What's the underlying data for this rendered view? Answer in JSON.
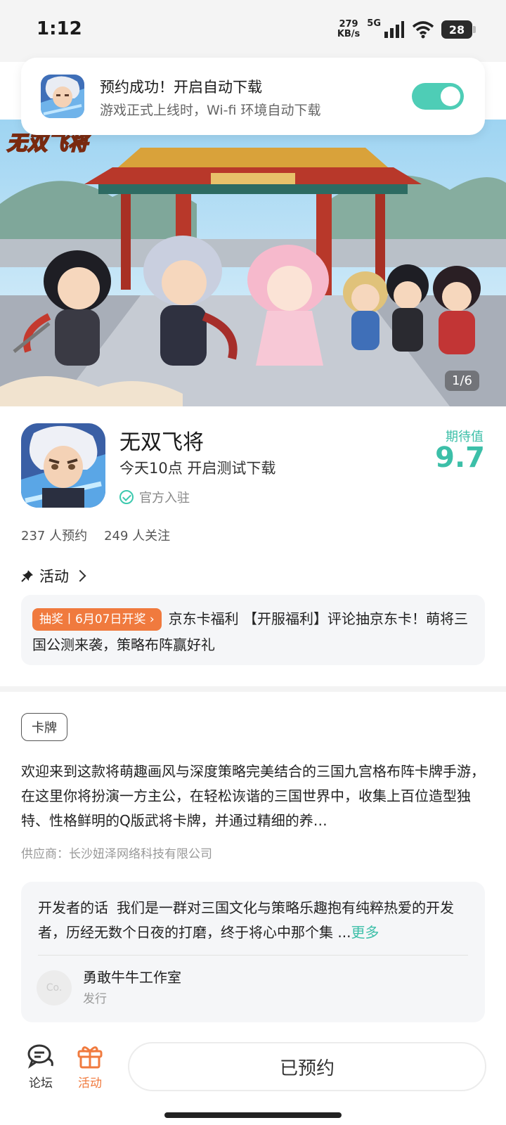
{
  "status_bar": {
    "time": "1:12",
    "net_speed_value": "279",
    "net_speed_unit": "KB/s",
    "network": "5G",
    "battery": "28"
  },
  "notification": {
    "title": "预约成功！开启自动下载",
    "subtitle": "游戏正式上线时，Wi-fi 环境自动下载",
    "toggle_on": true,
    "toggle_color": "#4ecdb6"
  },
  "banner": {
    "logo_text": "无双飞将",
    "counter": "1/6"
  },
  "game": {
    "name": "无双飞将",
    "test_info": "今天10点 开启测试下载",
    "official_label": "官方入驻",
    "expect_label": "期待值",
    "expect_value": "9.7",
    "accent_color": "#3cbfa8"
  },
  "stats": {
    "reservations": "237 人预约",
    "followers": "249 人关注"
  },
  "activity": {
    "section_title": "活动",
    "tag": "抽奖丨6月07日开奖",
    "text": "京东卡福利 【开服福利】评论抽京东卡！萌将三国公测来袭，策略布阵赢好礼",
    "tag_color": "#f07a3e"
  },
  "category_tag": "卡牌",
  "description": "欢迎来到这款将萌趣画风与深度策略完美结合的三国九宫格布阵卡牌手游，在这里你将扮演一方主公，在轻松诙谐的三国世界中，收集上百位造型独特、性格鲜明的Q版武将卡牌，并通过精细的养…",
  "supplier": "供应商：长沙妞泽网络科技有限公司",
  "developer": {
    "label": "开发者的话",
    "text": "我们是一群对三国文化与策略乐趣抱有纯粹热爱的开发者，历经无数个日夜的打磨，终于将心中那个集 ...",
    "more": "更多",
    "avatar_text": "Co.",
    "name": "勇敢牛牛工作室",
    "role": "发行"
  },
  "bottom_nav": {
    "forum_label": "论坛",
    "activity_label": "活动",
    "reserve_button": "已预约"
  }
}
